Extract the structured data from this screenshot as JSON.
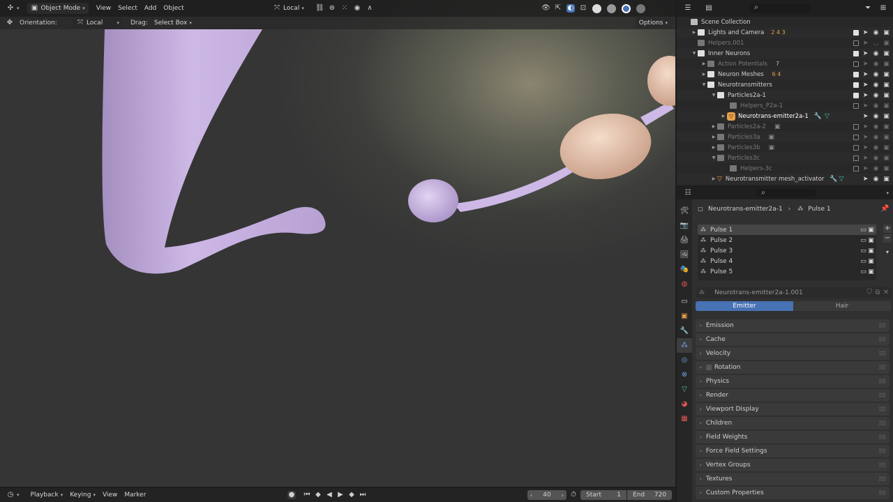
{
  "header": {
    "mode": "Object Mode",
    "menus": [
      "View",
      "Select",
      "Add",
      "Object"
    ],
    "transform_orientation": "Local",
    "options_label": "Options"
  },
  "toolsettings": {
    "orientation_label": "Orientation:",
    "orientation_value": "Local",
    "drag_label": "Drag:",
    "drag_value": "Select Box"
  },
  "outliner": {
    "rows": [
      {
        "label": "Scene Collection"
      },
      {
        "label": "Lights and Camera",
        "badge": "2 4 3"
      },
      {
        "label": "Helpers.001"
      },
      {
        "label": "Inner Neurons"
      },
      {
        "label": "Action Potentials",
        "badge": "7"
      },
      {
        "label": "Neuron Meshes",
        "badge": "6 4"
      },
      {
        "label": "Neurotransmitters"
      },
      {
        "label": "Particles2a-1"
      },
      {
        "label": "Helpers_P2a-1"
      },
      {
        "label": "Neurotrans-emitter2a-1"
      },
      {
        "label": "Particles2a-2"
      },
      {
        "label": "Particles3a"
      },
      {
        "label": "Particles3b"
      },
      {
        "label": "Particles3c"
      },
      {
        "label": "Helpers-3c"
      },
      {
        "label": "Neurotransmitter mesh_activator"
      }
    ]
  },
  "properties": {
    "breadcrumb_object": "Neurotrans-emitter2a-1",
    "breadcrumb_system": "Pulse 1",
    "systems": [
      "Pulse 1",
      "Pulse 2",
      "Pulse 3",
      "Pulse 4",
      "Pulse 5"
    ],
    "settings_name": "Neurotrans-emitter2a-1.001",
    "type_options": [
      "Emitter",
      "Hair"
    ],
    "panels": [
      "Emission",
      "Cache",
      "Velocity",
      "Rotation",
      "Physics",
      "Render",
      "Viewport Display",
      "Children",
      "Field Weights",
      "Force Field Settings",
      "Vertex Groups",
      "Textures",
      "Custom Properties"
    ]
  },
  "timeline": {
    "menus": [
      "Playback",
      "Keying",
      "View",
      "Marker"
    ],
    "current_frame": "40",
    "start_label": "Start",
    "start_value": "1",
    "end_label": "End",
    "end_value": "720"
  },
  "colors": {
    "accent": "#4772b3",
    "selection": "#334d80",
    "neuron_purple": "#c8b3e0",
    "vesicle_peach": "#e8c6ae"
  }
}
